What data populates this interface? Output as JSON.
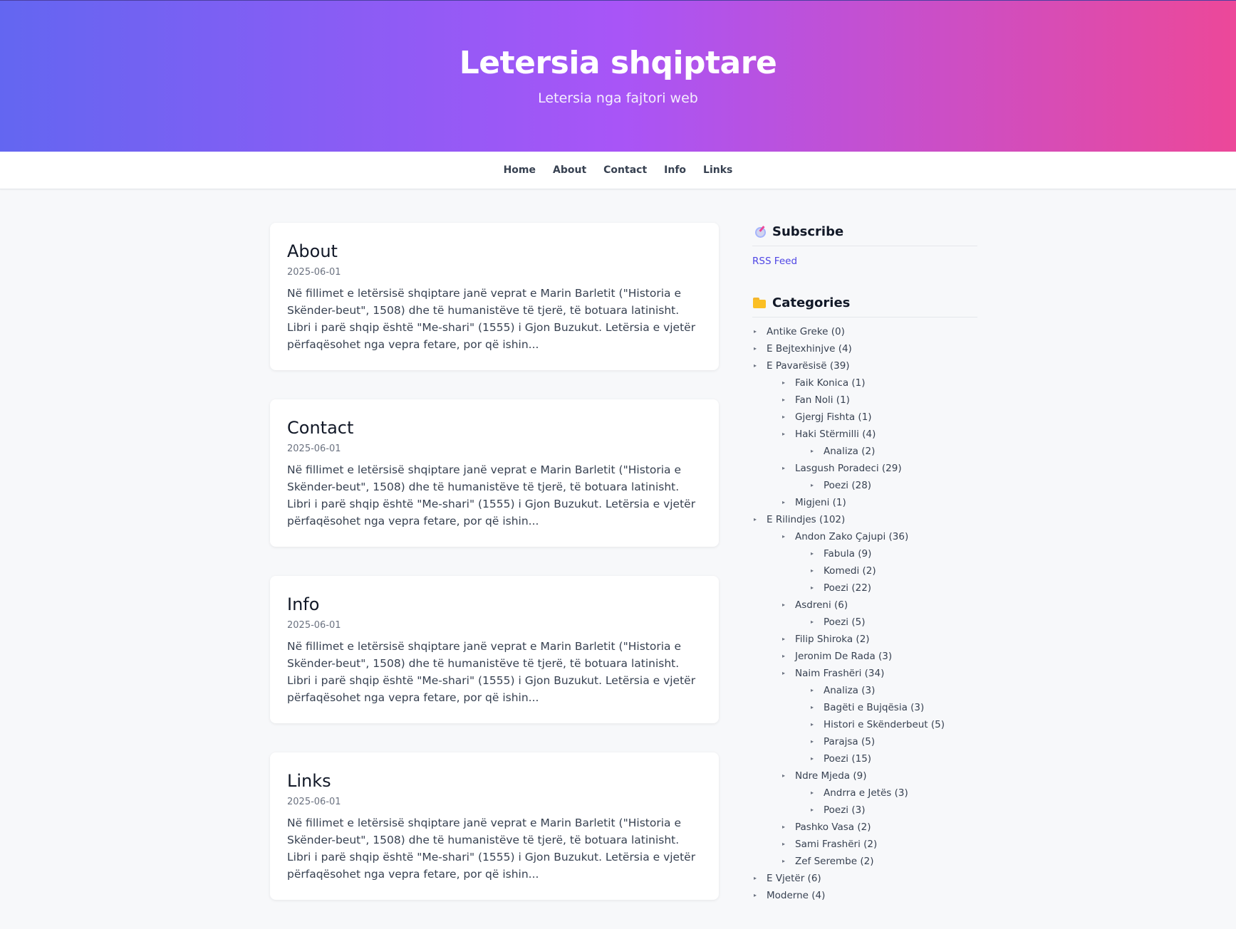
{
  "site": {
    "title": "Letersia shqiptare",
    "tagline": "Letersia nga fajtori web"
  },
  "colors": {
    "gradient_start": "#6366f1",
    "gradient_mid": "#a855f7",
    "gradient_end": "#ec4899",
    "link": "#4f46e5"
  },
  "nav": [
    "Home",
    "About",
    "Contact",
    "Info",
    "Links"
  ],
  "posts": [
    {
      "title": "About",
      "date": "2025-06-01",
      "excerpt": "Në fillimet e letërsisë shqiptare janë veprat e Marin Barletit (\"Historia e Skënder-beut\", 1508) dhe të humanistëve të tjerë, të botuara latinisht. Libri i parë shqip është \"Me-shari\" (1555) i Gjon Buzukut. Letërsia e vjetër përfaqësohet nga vepra fetare, por që ishin..."
    },
    {
      "title": "Contact",
      "date": "2025-06-01",
      "excerpt": "Në fillimet e letërsisë shqiptare janë veprat e Marin Barletit (\"Historia e Skënder-beut\", 1508) dhe të humanistëve të tjerë, të botuara latinisht. Libri i parë shqip është \"Me-shari\" (1555) i Gjon Buzukut. Letërsia e vjetër përfaqësohet nga vepra fetare, por që ishin..."
    },
    {
      "title": "Info",
      "date": "2025-06-01",
      "excerpt": "Në fillimet e letërsisë shqiptare janë veprat e Marin Barletit (\"Historia e Skënder-beut\", 1508) dhe të humanistëve të tjerë, të botuara latinisht. Libri i parë shqip është \"Me-shari\" (1555) i Gjon Buzukut. Letërsia e vjetër përfaqësohet nga vepra fetare, por që ishin..."
    },
    {
      "title": "Links",
      "date": "2025-06-01",
      "excerpt": "Në fillimet e letërsisë shqiptare janë veprat e Marin Barletit (\"Historia e Skënder-beut\", 1508) dhe të humanistëve të tjerë, të botuara latinisht. Libri i parë shqip është \"Me-shari\" (1555) i Gjon Buzukut. Letërsia e vjetër përfaqësohet nga vepra fetare, por që ishin..."
    }
  ],
  "subscribe": {
    "title": "Subscribe",
    "icon": "satellite-icon",
    "rss_label": "RSS Feed"
  },
  "categories": {
    "title": "Categories",
    "icon": "folder-icon",
    "items": [
      {
        "label": "Antike Greke (0)",
        "level": 0
      },
      {
        "label": "E Bejtexhinjve (4)",
        "level": 0
      },
      {
        "label": "E Pavarësisë (39)",
        "level": 0
      },
      {
        "label": "Faik Konica (1)",
        "level": 1
      },
      {
        "label": "Fan Noli (1)",
        "level": 1
      },
      {
        "label": "Gjergj Fishta (1)",
        "level": 1
      },
      {
        "label": "Haki Stërmilli (4)",
        "level": 1
      },
      {
        "label": "Analiza (2)",
        "level": 2
      },
      {
        "label": "Lasgush Poradeci (29)",
        "level": 1
      },
      {
        "label": "Poezi (28)",
        "level": 2
      },
      {
        "label": "Migjeni (1)",
        "level": 1
      },
      {
        "label": "E Rilindjes (102)",
        "level": 0
      },
      {
        "label": "Andon Zako Çajupi (36)",
        "level": 1
      },
      {
        "label": "Fabula (9)",
        "level": 2
      },
      {
        "label": "Komedi (2)",
        "level": 2
      },
      {
        "label": "Poezi (22)",
        "level": 2
      },
      {
        "label": "Asdreni (6)",
        "level": 1
      },
      {
        "label": "Poezi (5)",
        "level": 2
      },
      {
        "label": "Filip Shiroka (2)",
        "level": 1
      },
      {
        "label": "Jeronim De Rada (3)",
        "level": 1
      },
      {
        "label": "Naim Frashëri (34)",
        "level": 1
      },
      {
        "label": "Analiza (3)",
        "level": 2
      },
      {
        "label": "Bagëti e Bujqësia (3)",
        "level": 2
      },
      {
        "label": "Histori e Skënderbeut (5)",
        "level": 2
      },
      {
        "label": "Parajsa (5)",
        "level": 2
      },
      {
        "label": "Poezi (15)",
        "level": 2
      },
      {
        "label": "Ndre Mjeda (9)",
        "level": 1
      },
      {
        "label": "Andrra e Jetës (3)",
        "level": 2
      },
      {
        "label": "Poezi (3)",
        "level": 2
      },
      {
        "label": "Pashko Vasa (2)",
        "level": 1
      },
      {
        "label": "Sami Frashëri (2)",
        "level": 1
      },
      {
        "label": "Zef Serembe (2)",
        "level": 1
      },
      {
        "label": "E Vjetër (6)",
        "level": 0
      },
      {
        "label": "Moderne (4)",
        "level": 0
      }
    ]
  }
}
